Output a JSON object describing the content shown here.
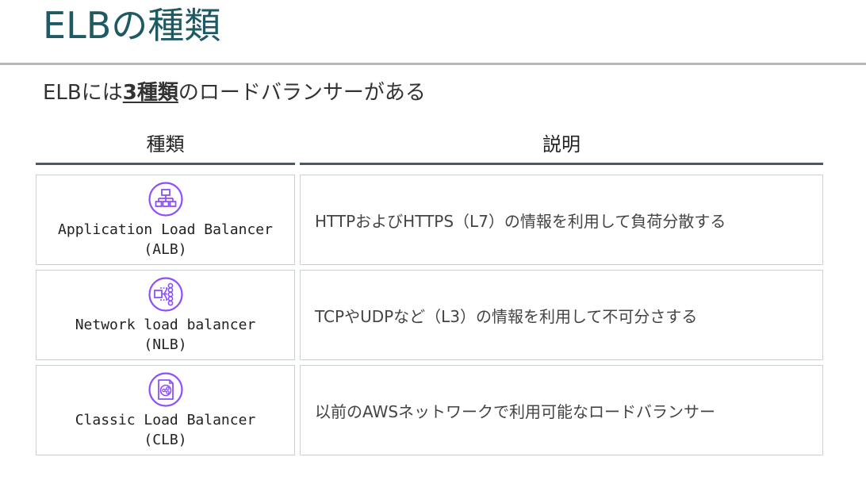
{
  "slide": {
    "title": "ELBの種類",
    "subtitle_pre": "ELBには",
    "subtitle_em": "3種類",
    "subtitle_post": "のロードバランサーがある"
  },
  "table": {
    "headers": [
      "種類",
      "説明"
    ],
    "rows": [
      {
        "icon": "application-load-balancer-icon",
        "name_line1": "Application Load Balancer",
        "name_line2": "(ALB)",
        "description": "HTTPおよびHTTPS（L7）の情報を利用して負荷分散する"
      },
      {
        "icon": "network-load-balancer-icon",
        "name_line1": "Network load balancer",
        "name_line2": "(NLB)",
        "description": "TCPやUDPなど（L3）の情報を利用して不可分さする"
      },
      {
        "icon": "classic-load-balancer-icon",
        "name_line1": "Classic Load Balancer",
        "name_line2": "(CLB)",
        "description": "以前のAWSネットワークで利用可能なロードバランサー"
      }
    ]
  },
  "colors": {
    "title": "#1f5a63",
    "icon_purple": "#8c4fff",
    "border": "#c9d1d5"
  }
}
